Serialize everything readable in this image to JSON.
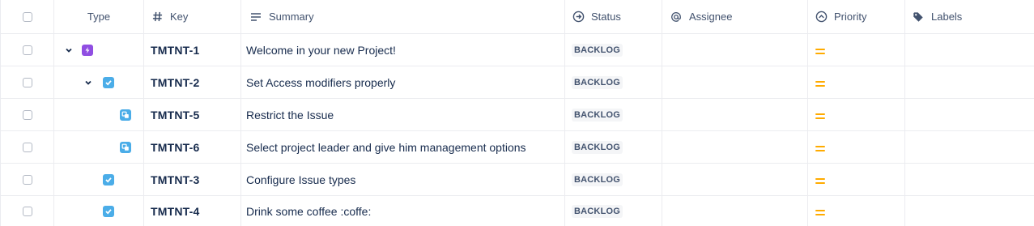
{
  "columns": {
    "type": "Type",
    "key": "Key",
    "summary": "Summary",
    "status": "Status",
    "assignee": "Assignee",
    "priority": "Priority",
    "labels": "Labels"
  },
  "rows": [
    {
      "key": "TMTNT-1",
      "summary": "Welcome in your new Project!",
      "status": "BACKLOG",
      "type": "epic",
      "priority": "medium"
    },
    {
      "key": "TMTNT-2",
      "summary": "Set Access modifiers properly",
      "status": "BACKLOG",
      "type": "task",
      "priority": "medium"
    },
    {
      "key": "TMTNT-5",
      "summary": "Restrict the Issue",
      "status": "BACKLOG",
      "type": "subtask",
      "priority": "medium"
    },
    {
      "key": "TMTNT-6",
      "summary": "Select project leader and give him management options",
      "status": "BACKLOG",
      "type": "subtask",
      "priority": "medium"
    },
    {
      "key": "TMTNT-3",
      "summary": "Configure Issue types",
      "status": "BACKLOG",
      "type": "task",
      "priority": "medium"
    },
    {
      "key": "TMTNT-4",
      "summary": "Drink some coffee :coffe:",
      "status": "BACKLOG",
      "type": "task",
      "priority": "medium"
    }
  ],
  "colors": {
    "epic": "#904ee2",
    "task": "#4bade8",
    "priority_medium": "#ffab00"
  }
}
